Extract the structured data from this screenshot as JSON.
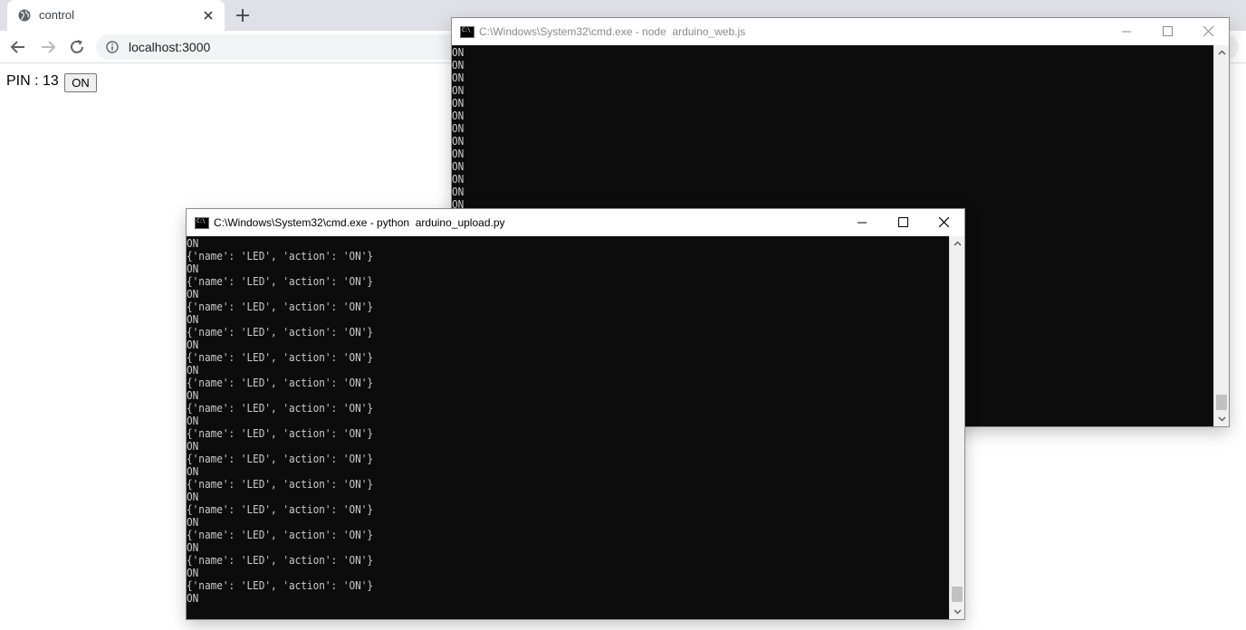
{
  "browser": {
    "tab_title": "control",
    "url": "localhost:3000"
  },
  "page": {
    "pin_label": "PIN : 13",
    "button_label": "ON"
  },
  "console_node": {
    "title": "C:\\Windows\\System32\\cmd.exe - node  arduino_web.js",
    "lines": [
      "ON",
      "ON",
      "ON",
      "ON",
      "ON",
      "ON",
      "ON",
      "ON",
      "ON",
      "ON",
      "ON",
      "ON",
      "ON"
    ]
  },
  "console_python": {
    "title": "C:\\Windows\\System32\\cmd.exe - python  arduino_upload.py",
    "lines": [
      "ON",
      "{'name': 'LED', 'action': 'ON'}",
      "ON",
      "{'name': 'LED', 'action': 'ON'}",
      "ON",
      "{'name': 'LED', 'action': 'ON'}",
      "ON",
      "{'name': 'LED', 'action': 'ON'}",
      "ON",
      "{'name': 'LED', 'action': 'ON'}",
      "ON",
      "{'name': 'LED', 'action': 'ON'}",
      "ON",
      "{'name': 'LED', 'action': 'ON'}",
      "ON",
      "{'name': 'LED', 'action': 'ON'}",
      "ON",
      "{'name': 'LED', 'action': 'ON'}",
      "ON",
      "{'name': 'LED', 'action': 'ON'}",
      "ON",
      "{'name': 'LED', 'action': 'ON'}",
      "ON",
      "{'name': 'LED', 'action': 'ON'}",
      "ON",
      "{'name': 'LED', 'action': 'ON'}",
      "ON",
      "{'name': 'LED', 'action': 'ON'}",
      "ON"
    ]
  },
  "icons": {
    "tab_favicon": "globe-icon",
    "tab_close": "close-icon",
    "new_tab": "plus-icon",
    "back": "arrow-left-icon",
    "forward": "arrow-right-icon",
    "reload": "reload-icon",
    "site_info": "info-icon",
    "console_app": "cmd-icon",
    "minimize": "minimize-icon",
    "maximize": "maximize-icon",
    "close": "close-icon"
  },
  "colors": {
    "console_bg": "#0c0c0c",
    "console_text": "#cccccc",
    "tabstrip_bg": "#dee1e6"
  }
}
